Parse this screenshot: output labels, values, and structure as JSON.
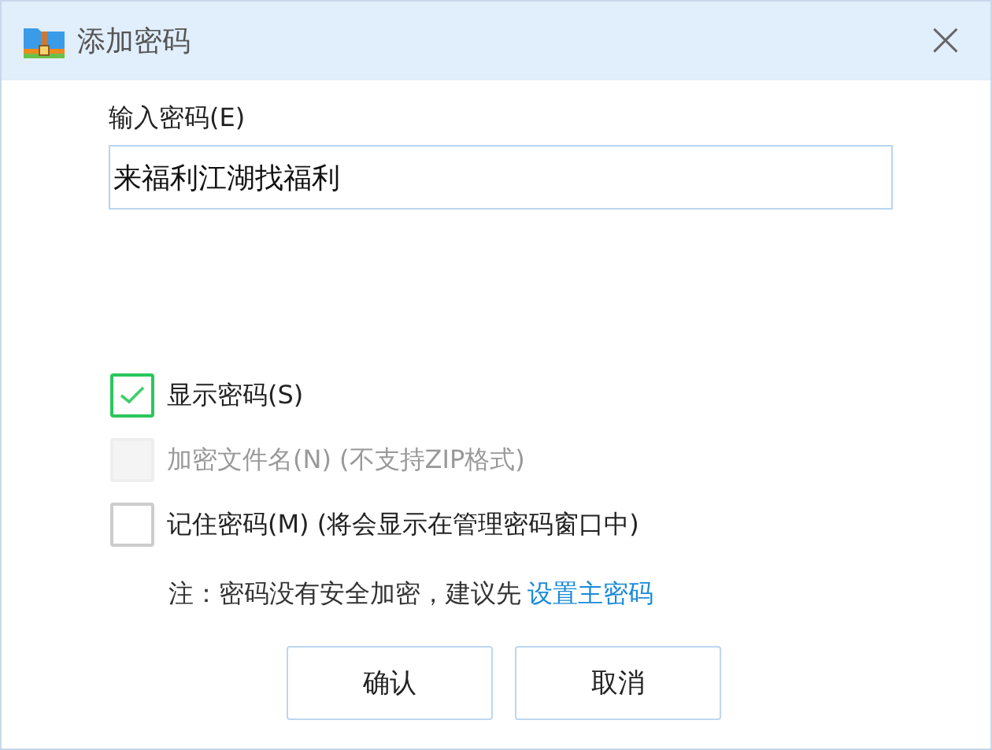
{
  "window": {
    "title": "添加密码",
    "close": "×"
  },
  "password": {
    "label": "输入密码(E)",
    "value": "来福利江湖找福利"
  },
  "options": [
    {
      "label": "显示密码(S)",
      "checked": true,
      "disabled": false
    },
    {
      "label": "加密文件名(N) (不支持ZIP格式)",
      "checked": false,
      "disabled": true
    },
    {
      "label": "记住密码(M) (将会显示在管理密码窗口中)",
      "checked": false,
      "disabled": false
    }
  ],
  "note": {
    "text": "注：密码没有安全加密，建议先",
    "link": "设置主密码"
  },
  "buttons": [
    "确认",
    "取消"
  ]
}
